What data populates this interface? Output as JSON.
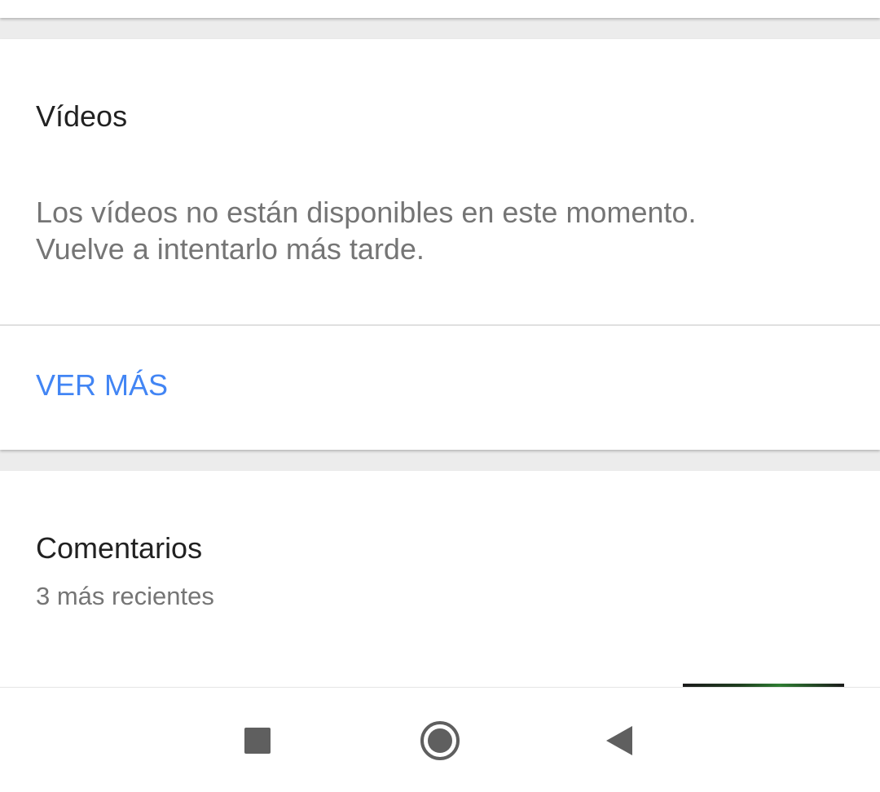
{
  "videos": {
    "title": "Vídeos",
    "message_line1": "Los vídeos no están disponibles en este momento.",
    "message_line2": "Vuelve a intentarlo más tarde.",
    "see_more_label": "VER MÁS"
  },
  "comments": {
    "title": "Comentarios",
    "subtitle": "3 más recientes"
  },
  "nav_bar": {
    "recents_icon": "square-icon",
    "home_icon": "home-circle-icon",
    "back_icon": "back-triangle-icon"
  },
  "colors": {
    "accent": "#4285f4",
    "title_text": "#212121",
    "secondary_text": "#757575",
    "background": "#ececec"
  }
}
